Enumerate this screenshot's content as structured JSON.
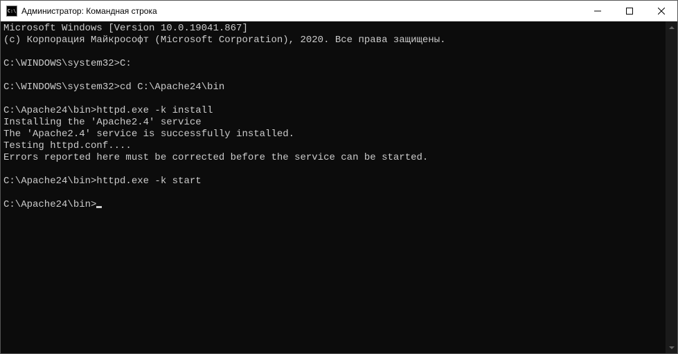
{
  "window": {
    "icon_text": "C:\\",
    "title": "Администратор: Командная строка"
  },
  "terminal": {
    "lines": [
      "Microsoft Windows [Version 10.0.19041.867]",
      "(c) Корпорация Майкрософт (Microsoft Corporation), 2020. Все права защищены.",
      "",
      "C:\\WINDOWS\\system32>C:",
      "",
      "C:\\WINDOWS\\system32>cd C:\\Apache24\\bin",
      "",
      "C:\\Apache24\\bin>httpd.exe -k install",
      "Installing the 'Apache2.4' service",
      "The 'Apache2.4' service is successfully installed.",
      "Testing httpd.conf....",
      "Errors reported here must be corrected before the service can be started.",
      "",
      "C:\\Apache24\\bin>httpd.exe -k start",
      "",
      "C:\\Apache24\\bin>"
    ],
    "prompt_index": 15
  }
}
